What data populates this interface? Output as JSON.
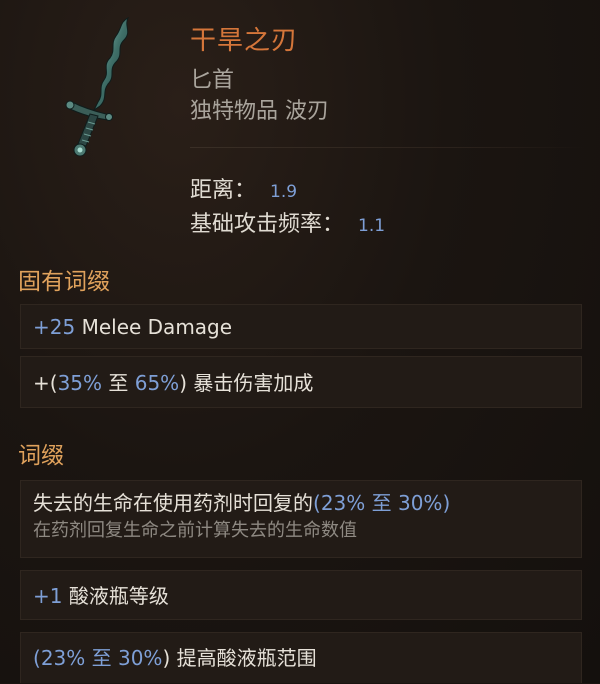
{
  "item": {
    "name": "干旱之刃",
    "type": "匕首",
    "rarity": "独特物品 波刃",
    "icon": "wavy-dagger-icon",
    "name_color": "#d5763a"
  },
  "stats": {
    "range_label": "距离：",
    "range_value": "1.9",
    "speed_label": "基础攻击频率：",
    "speed_value": "1.1"
  },
  "implicit": {
    "title": "固有词缀",
    "mods": [
      {
        "num": "+25",
        "text": " Melee Damage"
      },
      {
        "pre": "+(",
        "num1": "35%",
        "mid": " 至 ",
        "num2": "65%",
        "post": ") 暴击伤害加成"
      }
    ]
  },
  "affixes": {
    "title": "词缀",
    "mods": [
      {
        "text": "失去的生命在使用药剂时回复的",
        "range_open": "(",
        "num1": "23%",
        "mid": " 至 ",
        "num2": "30%",
        "range_close": ")",
        "sub": "在药剂回复生命之前计算失去的生命数值"
      },
      {
        "num": "+1",
        "text": " 酸液瓶等级"
      },
      {
        "pre": "(",
        "num1": "23%",
        "mid": " 至 ",
        "num2": "30%",
        "post": ") 提高酸液瓶范围"
      }
    ]
  },
  "colors": {
    "value_blue": "#7e9fd6",
    "section_gold": "#e0a25c",
    "mod_background": "#221b16"
  }
}
